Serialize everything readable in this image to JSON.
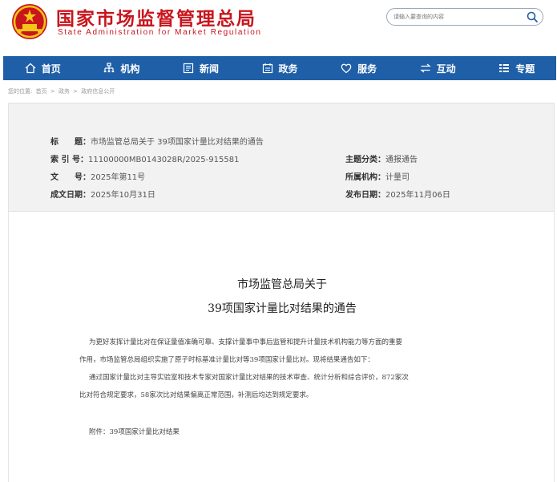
{
  "header": {
    "site_title": "国家市场监督管理总局",
    "site_subtitle": "State Administration for Market Regulation",
    "search_placeholder": "请输入要查询的内容",
    "colors": {
      "brand_red": "#c8161d",
      "nav_blue": "#1e5fa8"
    }
  },
  "nav": {
    "items": [
      {
        "label": "首页",
        "icon": "home-icon"
      },
      {
        "label": "机构",
        "icon": "org-icon"
      },
      {
        "label": "新闻",
        "icon": "news-icon"
      },
      {
        "label": "政务",
        "icon": "affairs-icon"
      },
      {
        "label": "服务",
        "icon": "heart-icon"
      },
      {
        "label": "互动",
        "icon": "exchange-icon"
      },
      {
        "label": "专题",
        "icon": "topic-icon"
      }
    ]
  },
  "breadcrumb": {
    "prefix": "您的位置:",
    "items": [
      "首页",
      "政务",
      "政府信息公开"
    ],
    "separator": ">"
  },
  "info": {
    "title_label": "标　　题：",
    "title_value": "市场监管总局关于 39项国家计量比对结果的通告",
    "index_label": "索 引 号：",
    "index_value": "11100000MB0143028R/2025-915581",
    "doc_no_label": "文　　号：",
    "doc_no_value": "2025年第11号",
    "created_label": "成文日期：",
    "created_value": "2025年10月31日",
    "category_label": "主题分类：",
    "category_value": "通报通告",
    "agency_label": "所属机构：",
    "agency_value": "计量司",
    "published_label": "发布日期：",
    "published_value": "2025年11月06日"
  },
  "document": {
    "title_line1": "市场监管总局关于",
    "title_line2": "39项国家计量比对结果的通告",
    "para1_line1": "为更好发挥计量比对在保证量值准确可靠、支撑计量事中事后监管和提升计量技术机构能力等方面的重要",
    "para1_line2": "作用，市场监管总局组织实施了原子时标基准计量比对等39项国家计量比对。现将结果通告如下：",
    "para2_line1": "通过国家计量比对主导实验室和技术专家对国家计量比对结果的技术审查、统计分析和综合评价，872家次",
    "para2_line2": "比对符合规定要求，58家次比对结果偏离正常范围，补测后均达到规定要求。",
    "attachment": "附件：39项国家计量比对结果"
  }
}
